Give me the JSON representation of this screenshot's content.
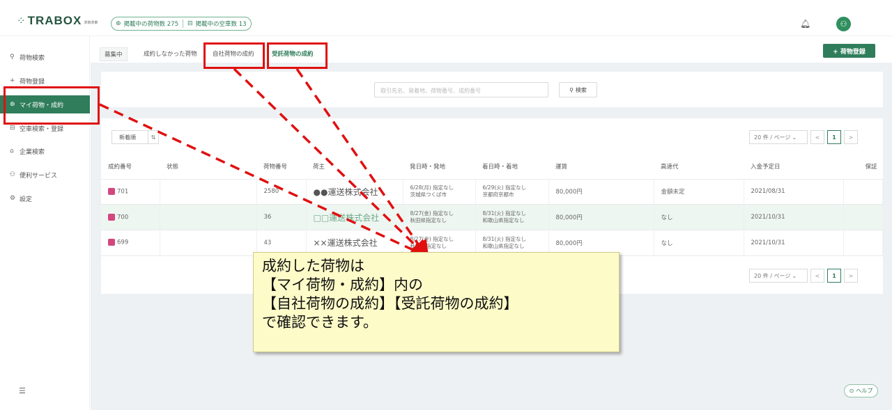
{
  "header": {
    "logo_text": "TRABOX",
    "logo_sub": "求荷求車",
    "stats": [
      {
        "label": "掲載中の荷物数 275"
      },
      {
        "label": "掲載中の空車数 13"
      }
    ]
  },
  "sidebar": {
    "items": [
      {
        "label": "荷物検索",
        "icon": "search-icon"
      },
      {
        "label": "荷物登録",
        "icon": "plus-icon"
      },
      {
        "label": "マイ荷物・成約",
        "icon": "box-icon",
        "active": true
      },
      {
        "label": "空車検索・登録",
        "icon": "truck-icon"
      },
      {
        "label": "企業検索",
        "icon": "building-icon"
      },
      {
        "label": "便利サービス",
        "icon": "people-icon"
      },
      {
        "label": "設定",
        "icon": "gear-icon"
      }
    ]
  },
  "tabs": [
    {
      "label": "募集中"
    },
    {
      "label": "成約しなかった荷物"
    },
    {
      "label": "自社荷物の成約"
    },
    {
      "label": "受託荷物の成約"
    }
  ],
  "register_button": "+ 荷物登録",
  "search": {
    "placeholder": "取引先名、発着地、荷物番号、成約番号",
    "button": "検索"
  },
  "sort": {
    "label": "新着順"
  },
  "pager": {
    "page_size": "20 件 / ページ",
    "current_page": "1"
  },
  "table": {
    "columns": [
      "成約番号",
      "状態",
      "荷物番号",
      "荷主",
      "発日時・発地",
      "着日時・着地",
      "運賃",
      "高速代",
      "入金予定日",
      "保証"
    ],
    "rows": [
      {
        "contract_no": "701",
        "status": "",
        "cargo_no": "2580",
        "shipper": "●●運送株式会社",
        "dep_date": "6/28(月) 指定なし",
        "dep_place": "茨城県つくば市",
        "arr_date": "6/29(火) 指定なし",
        "arr_place": "京都府京都市",
        "fare": "80,000円",
        "highway": "金額未定",
        "payment_date": "2021/08/31",
        "guarantee": ""
      },
      {
        "contract_no": "700",
        "status": "",
        "cargo_no": "36",
        "shipper": "□□運送株式会社",
        "dep_date": "8/27(金) 指定なし",
        "dep_place": "秋田県指定なし",
        "arr_date": "8/31(火) 指定なし",
        "arr_place": "和歌山県指定なし",
        "fare": "80,000円",
        "highway": "なし",
        "payment_date": "2021/10/31",
        "guarantee": ""
      },
      {
        "contract_no": "699",
        "status": "",
        "cargo_no": "43",
        "shipper": "××運送株式会社",
        "dep_date": "8/27(金) 指定なし",
        "dep_place": "秋田県指定なし",
        "arr_date": "8/31(火) 指定なし",
        "arr_place": "和歌山県指定なし",
        "fare": "80,000円",
        "highway": "なし",
        "payment_date": "2021/10/31",
        "guarantee": ""
      }
    ]
  },
  "help_button": "ヘルプ",
  "callout": {
    "lines": [
      "成約した荷物は",
      "【マイ荷物・成約】内の",
      "【自社荷物の成約】【受託荷物の成約】",
      "で確認できます。"
    ]
  },
  "colors": {
    "brand": "#2f7d5b",
    "annotation": "#e01010",
    "badge": "#d4467e"
  }
}
